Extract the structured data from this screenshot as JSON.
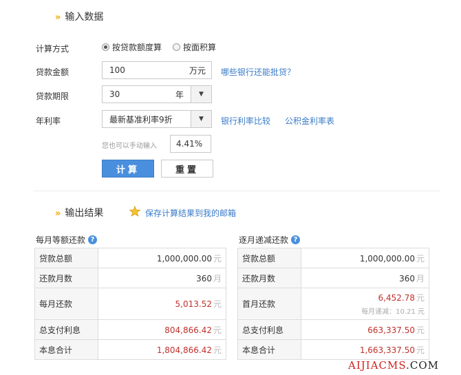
{
  "input_section": {
    "title": "输入数据",
    "calc_method": {
      "label": "计算方式",
      "options": [
        "按贷款额度算",
        "按面积算"
      ],
      "selected": "按贷款额度算"
    },
    "loan_amount": {
      "label": "贷款金额",
      "value": "100",
      "unit": "万元",
      "link": "哪些银行还能批贷？"
    },
    "loan_term": {
      "label": "贷款期限",
      "value": "30",
      "unit": "年"
    },
    "rate": {
      "label": "年利率",
      "selected": "最新基准利率9折",
      "link_bank": "银行利率比较",
      "link_fund": "公积金利率表",
      "manual_hint": "您也可以手动输入",
      "manual_value": "4.41%"
    },
    "buttons": {
      "calc": "计算",
      "reset": "重置"
    }
  },
  "output_section": {
    "title": "输出结果",
    "save_link": "保存计算结果到我的邮箱",
    "equal_payment": {
      "title": "每月等额还款",
      "rows": [
        {
          "label": "贷款总额",
          "value": "1,000,000.00",
          "unit": "元"
        },
        {
          "label": "还款月数",
          "value": "360",
          "unit": "月"
        },
        {
          "label": "每月还款",
          "value": "5,013.52",
          "unit": "元"
        },
        {
          "label": "总支付利息",
          "value": "804,866.42",
          "unit": "元"
        },
        {
          "label": "本息合计",
          "value": "1,804,866.42",
          "unit": "元"
        }
      ]
    },
    "decreasing_payment": {
      "title": "逐月递减还款",
      "rows": [
        {
          "label": "贷款总额",
          "value": "1,000,000.00",
          "unit": "元"
        },
        {
          "label": "还款月数",
          "value": "360",
          "unit": "月"
        },
        {
          "label": "首月还款",
          "value": "6,452.78",
          "unit": "元",
          "note": "每月递减：10.21 元"
        },
        {
          "label": "总支付利息",
          "value": "663,337.50",
          "unit": "元"
        },
        {
          "label": "本息合计",
          "value": "1,663,337.50",
          "unit": "元"
        }
      ]
    }
  },
  "watermark": {
    "part1": "AIJIACMS",
    "part2": ".COM"
  },
  "colors": {
    "accent_blue": "#4a8fde",
    "link_blue": "#3a7bc8",
    "value_red": "#c0302b",
    "arrow_orange": "#f0a800",
    "watermark_red": "#d21e1e"
  }
}
